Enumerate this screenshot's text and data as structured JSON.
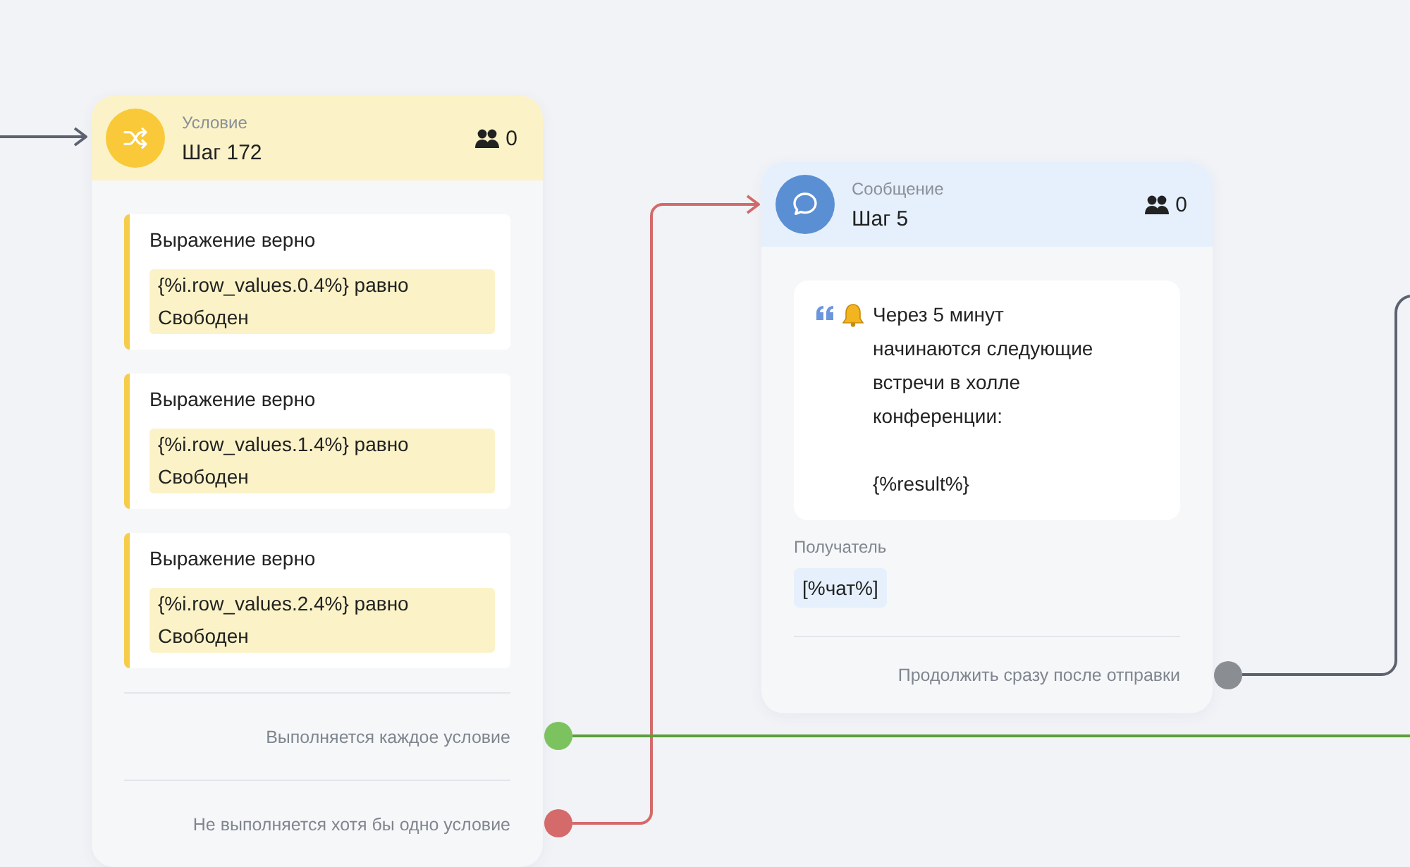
{
  "nodes": [
    {
      "kind": "condition",
      "type_label": "Условие",
      "title": "Шаг 172",
      "users": "0",
      "conditions": [
        {
          "heading": "Выражение верно",
          "expression": "{%i.row_values.0.4%} равно Свободен"
        },
        {
          "heading": "Выражение верно",
          "expression": "{%i.row_values.1.4%} равно Свободен"
        },
        {
          "heading": "Выражение верно",
          "expression": "{%i.row_values.2.4%} равно Свободен"
        }
      ],
      "outputs": [
        {
          "label": "Выполняется каждое условие",
          "color": "#7cc35f"
        },
        {
          "label": "Не выполняется хотя бы одно условие",
          "color": "#d46a6a"
        }
      ]
    },
    {
      "kind": "message",
      "type_label": "Сообщение",
      "title": "Шаг 5",
      "users": "0",
      "message": "Через 5 минут начинаются следующие встречи в холле конференции:\n\n{%result%}",
      "recipient_label": "Получатель",
      "recipient": "[%чат%]",
      "outputs": [
        {
          "label": "Продолжить сразу после отправки",
          "color": "#8a8d92"
        }
      ]
    }
  ]
}
